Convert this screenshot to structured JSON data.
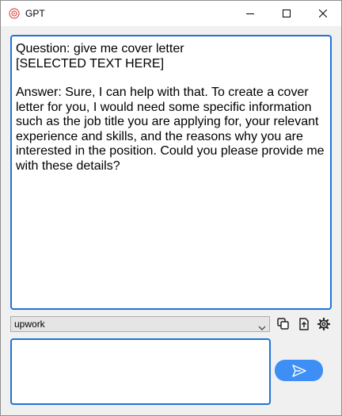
{
  "window": {
    "title": "GPT",
    "app_icon": "openai-logo-icon",
    "controls": [
      "minimize-icon",
      "maximize-icon",
      "close-icon"
    ]
  },
  "output": {
    "question_line": "Question: give me cover letter",
    "selected_line": "[SELECTED TEXT HERE]",
    "answer": "Answer: Sure, I can help with that. To create a cover letter for you, I would need some specific information such as the job title you are applying for, your relevant experience and skills, and the reasons why you are interested in the position. Could you please provide me with these details?"
  },
  "prompt_select": {
    "value": "upwork"
  },
  "toolbar_icons": [
    "copy-icon",
    "export-icon",
    "gear-icon"
  ],
  "input": {
    "value": "",
    "placeholder": ""
  },
  "send": {
    "icon": "send-icon"
  },
  "colors": {
    "accent": "#1f73d6",
    "send_button": "#3d8ff5",
    "window_bg": "#f0f0f0"
  }
}
